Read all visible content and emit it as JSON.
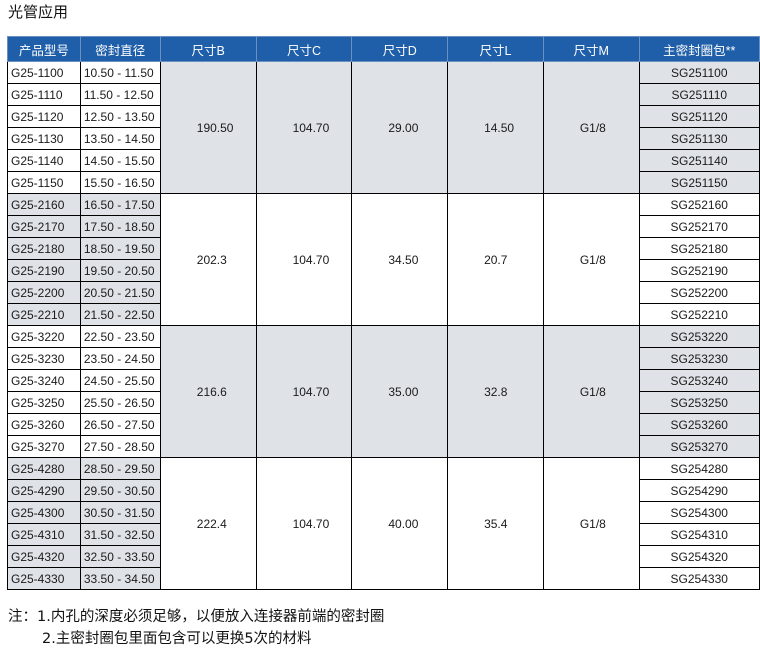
{
  "section_title": "光管应用",
  "table": {
    "headers": [
      "产品型号",
      "密封直径",
      "尺寸B",
      "尺寸C",
      "尺寸D",
      "尺寸L",
      "尺寸M",
      "主密封圈包**"
    ],
    "groups": [
      {
        "B": "190.50",
        "C": "104.70",
        "D": "29.00",
        "L": "14.50",
        "M": "G1/8",
        "rows": [
          {
            "model": "G25-1100",
            "diameter": "10.50 - 11.50",
            "seal": "SG251100"
          },
          {
            "model": "G25-1110",
            "diameter": "11.50 - 12.50",
            "seal": "SG251110"
          },
          {
            "model": "G25-1120",
            "diameter": "12.50 - 13.50",
            "seal": "SG251120"
          },
          {
            "model": "G25-1130",
            "diameter": "13.50 - 14.50",
            "seal": "SG251130"
          },
          {
            "model": "G25-1140",
            "diameter": "14.50 - 15.50",
            "seal": "SG251140"
          },
          {
            "model": "G25-1150",
            "diameter": "15.50 - 16.50",
            "seal": "SG251150"
          }
        ]
      },
      {
        "B": "202.3",
        "C": "104.70",
        "D": "34.50",
        "L": "20.7",
        "M": "G1/8",
        "rows": [
          {
            "model": "G25-2160",
            "diameter": "16.50 - 17.50",
            "seal": "SG252160"
          },
          {
            "model": "G25-2170",
            "diameter": "17.50 - 18.50",
            "seal": "SG252170"
          },
          {
            "model": "G25-2180",
            "diameter": "18.50 - 19.50",
            "seal": "SG252180"
          },
          {
            "model": "G25-2190",
            "diameter": "19.50 - 20.50",
            "seal": "SG252190"
          },
          {
            "model": "G25-2200",
            "diameter": "20.50 - 21.50",
            "seal": "SG252200"
          },
          {
            "model": "G25-2210",
            "diameter": "21.50 - 22.50",
            "seal": "SG252210"
          }
        ]
      },
      {
        "B": "216.6",
        "C": "104.70",
        "D": "35.00",
        "L": "32.8",
        "M": "G1/8",
        "rows": [
          {
            "model": "G25-3220",
            "diameter": "22.50 - 23.50",
            "seal": "SG253220"
          },
          {
            "model": "G25-3230",
            "diameter": "23.50 - 24.50",
            "seal": "SG253230"
          },
          {
            "model": "G25-3240",
            "diameter": "24.50 - 25.50",
            "seal": "SG253240"
          },
          {
            "model": "G25-3250",
            "diameter": "25.50 - 26.50",
            "seal": "SG253250"
          },
          {
            "model": "G25-3260",
            "diameter": "26.50 - 27.50",
            "seal": "SG253260"
          },
          {
            "model": "G25-3270",
            "diameter": "27.50 - 28.50",
            "seal": "SG253270"
          }
        ]
      },
      {
        "B": "222.4",
        "C": "104.70",
        "D": "40.00",
        "L": "35.4",
        "M": "G1/8",
        "rows": [
          {
            "model": "G25-4280",
            "diameter": "28.50 - 29.50",
            "seal": "SG254280"
          },
          {
            "model": "G25-4290",
            "diameter": "29.50 - 30.50",
            "seal": "SG254290"
          },
          {
            "model": "G25-4300",
            "diameter": "30.50 - 31.50",
            "seal": "SG254300"
          },
          {
            "model": "G25-4310",
            "diameter": "31.50 - 32.50",
            "seal": "SG254310"
          },
          {
            "model": "G25-4320",
            "diameter": "32.50 - 33.50",
            "seal": "SG254320"
          },
          {
            "model": "G25-4330",
            "diameter": "33.50 - 34.50",
            "seal": "SG254330"
          }
        ]
      }
    ]
  },
  "notes": {
    "line1": "注：1.内孔的深度必须足够，以便放入连接器前端的密封圈",
    "line2": "2.主密封圈包里面包含可以更换5次的材料"
  },
  "colors": {
    "header_bg": "#1f5ea8",
    "header_text": "#ffffff",
    "band_alt": "#dfe3e8"
  }
}
